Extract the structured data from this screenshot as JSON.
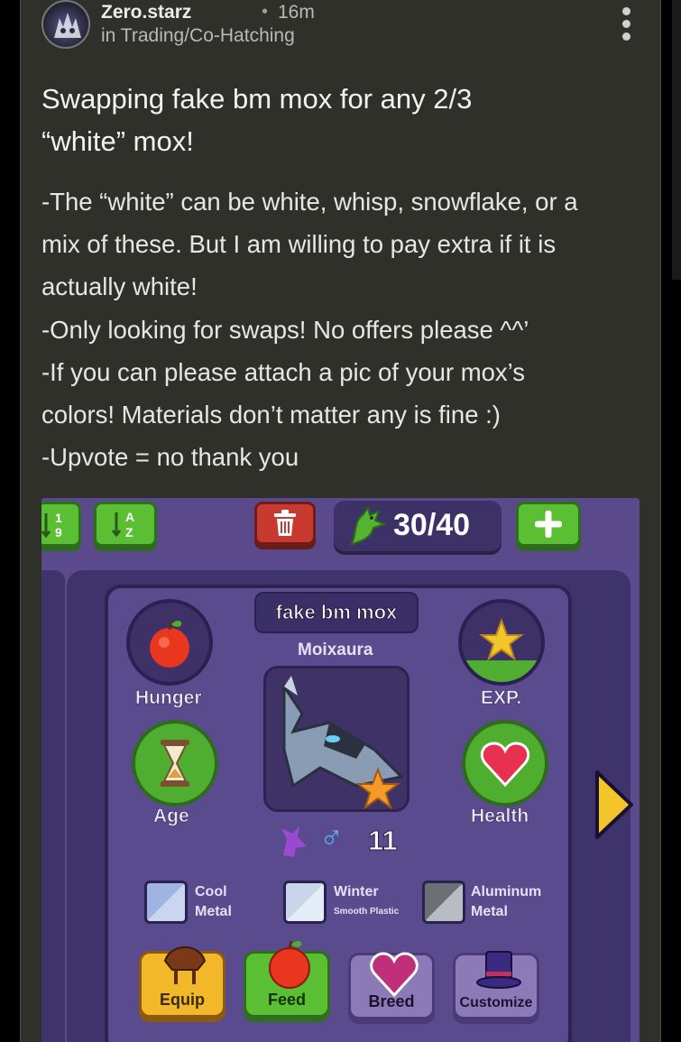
{
  "post": {
    "author": "Zero.starz",
    "separator": "•",
    "time": "16m",
    "community": "in Trading/Co-Hatching",
    "title_line1": "Swapping fake bm mox for any 2/3",
    "title_line2": "“white” mox!",
    "body_lines": [
      "-The “white” can be white, whisp, snowflake, or a",
      "mix of these. But I am willing to pay extra if it is",
      "actually white!",
      "-Only looking for swaps! No offers please ^^’",
      "-If you can please attach a pic of your mox’s",
      "colors! Materials don’t matter any is fine :)",
      "-Upvote = no thank you"
    ]
  },
  "game": {
    "count": "30/40",
    "pet_name": "fake bm mox",
    "species": "Moixaura",
    "level": "11",
    "gender_symbol": "♂",
    "stats": {
      "hunger": "Hunger",
      "exp": "EXP.",
      "age": "Age",
      "health": "Health"
    },
    "materials": [
      {
        "line1": "Cool",
        "line2": "Metal",
        "color": "#9fb4e0"
      },
      {
        "line1": "Winter",
        "line2": "Smooth Plastic",
        "color": "#c9d6ea"
      },
      {
        "line1": "Aluminum",
        "line2": "Metal",
        "color": "#6c6f74"
      }
    ],
    "actions": {
      "equip": "Equip",
      "feed": "Feed",
      "breed": "Breed",
      "customize": "Customize"
    },
    "sort_labels": {
      "numeric": "1 9",
      "alpha": "A Z"
    },
    "colors": {
      "panel": "#5a4b8e",
      "green_button": "#5bbf34",
      "red_button": "#c83a30",
      "gold": "#f3b72a"
    }
  }
}
